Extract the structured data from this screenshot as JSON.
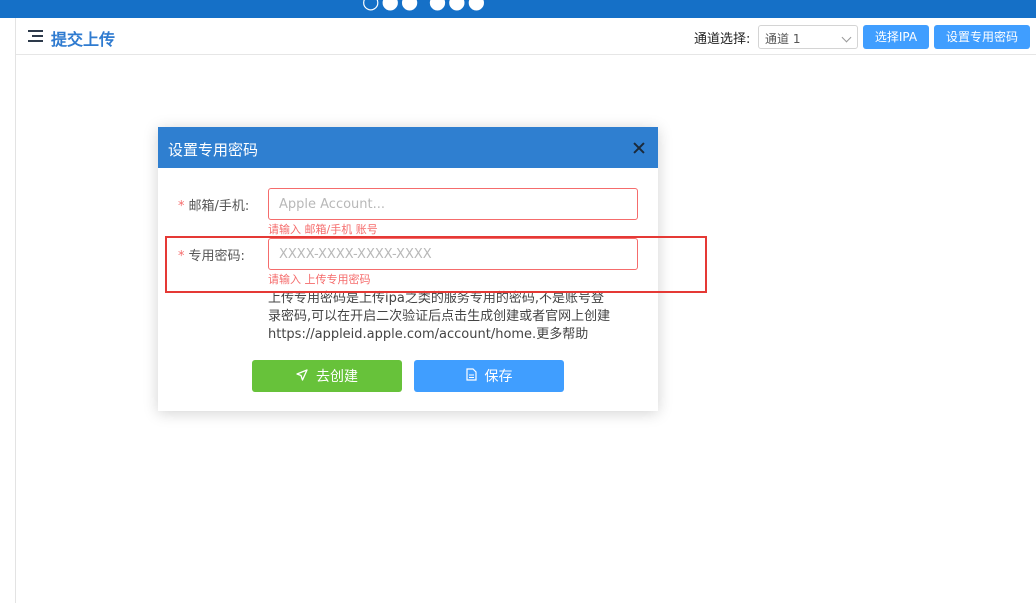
{
  "header": {
    "title": "提交上传",
    "channel_label": "通道选择:",
    "channel_value": "通道 1",
    "select_ipa_label": "选择IPA",
    "set_password_label": "设置专用密码"
  },
  "dialog": {
    "title": "设置专用密码",
    "account": {
      "required_mark": "*",
      "label": "邮箱/手机:",
      "placeholder": "Apple Account...",
      "error": "请输入 邮箱/手机 账号"
    },
    "password": {
      "required_mark": "*",
      "label": "专用密码:",
      "placeholder": "XXXX-XXXX-XXXX-XXXX",
      "error": "请输入 上传专用密码"
    },
    "help_lines": [
      "上传专用密码是上传ipa之类的服务专用的密码,不是账号登",
      "录密码,可以在开启二次验证后点击生成创建或者官网上创建",
      "https://appleid.apple.com/account/home.更多帮助"
    ],
    "create_label": "去创建",
    "save_label": "保存"
  },
  "colors": {
    "banner": "#1570c7",
    "dialog_header": "#2f7fd0",
    "primary": "#409eff",
    "success": "#67c23a",
    "error": "#f56c6c",
    "highlight": "#e53935"
  },
  "icons": [
    "menu-icon",
    "chevron-down-icon",
    "close-icon",
    "send-icon",
    "document-icon"
  ]
}
